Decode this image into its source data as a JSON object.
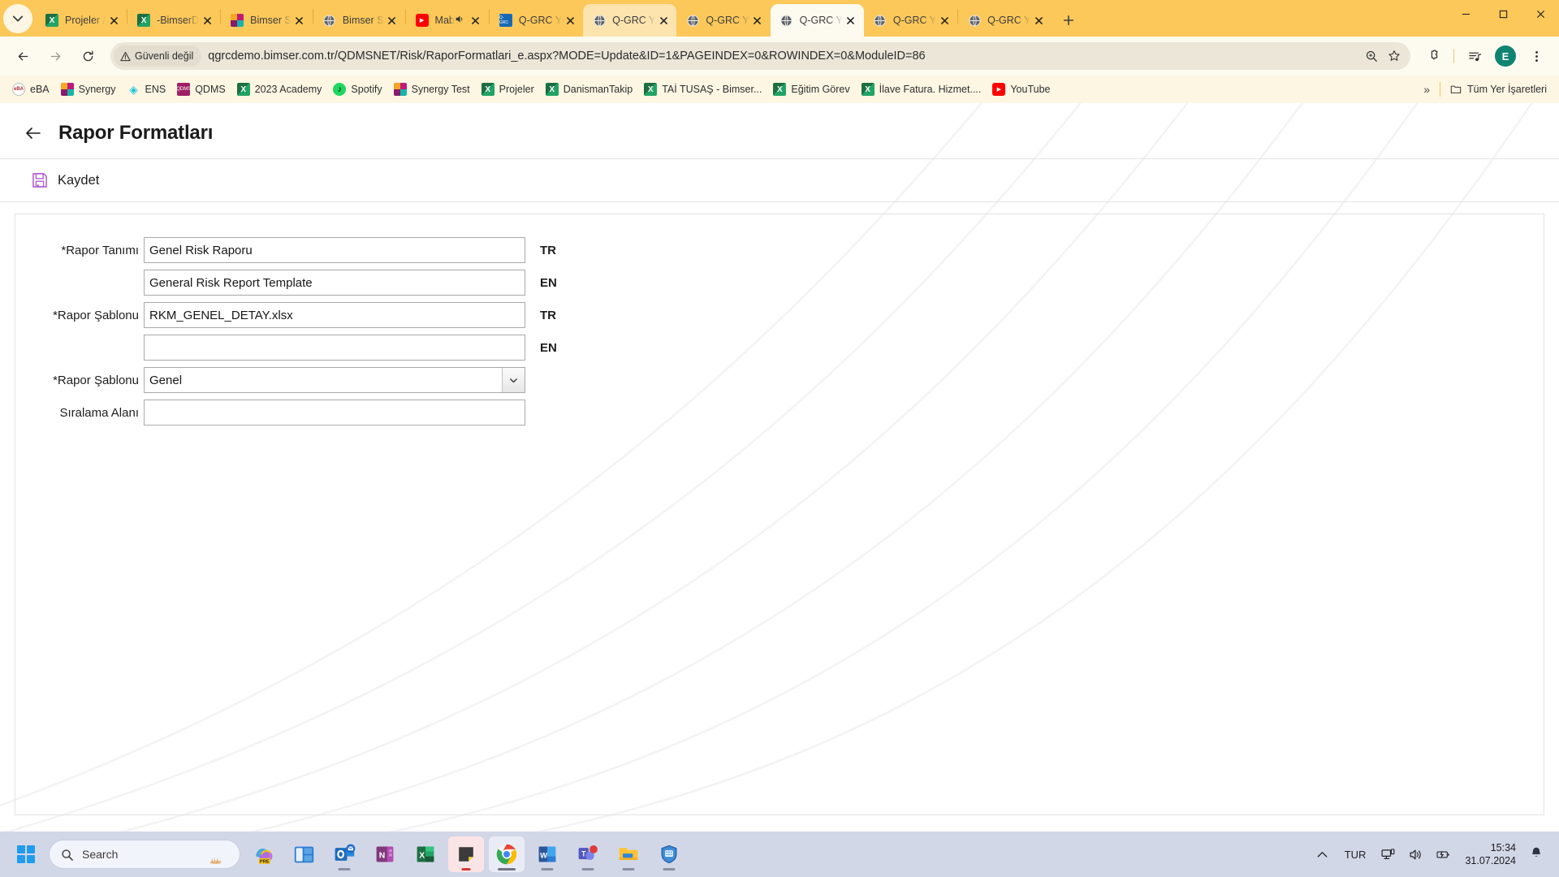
{
  "browser": {
    "tab_search_icon": "chevron-down-icon",
    "tabs": [
      {
        "title": "Projeler /",
        "icon": "excel-icon",
        "state": "normal",
        "audio": false
      },
      {
        "title": "-BimserD",
        "icon": "excel-icon",
        "state": "normal",
        "audio": false
      },
      {
        "title": "Bimser S",
        "icon": "synergy-icon",
        "state": "normal",
        "audio": false
      },
      {
        "title": "Bimser S",
        "icon": "globe-icon",
        "state": "normal",
        "audio": false
      },
      {
        "title": "Mab",
        "icon": "youtube-icon",
        "state": "normal",
        "audio": true
      },
      {
        "title": "Q-GRC Y",
        "icon": "qgrc-icon",
        "state": "normal",
        "audio": false
      },
      {
        "title": "Q-GRC Y",
        "icon": "globe-icon",
        "state": "hover",
        "audio": false
      },
      {
        "title": "Q-GRC Y",
        "icon": "globe-icon",
        "state": "normal",
        "audio": false
      },
      {
        "title": "Q-GRC Y",
        "icon": "globe-icon",
        "state": "active",
        "audio": false
      },
      {
        "title": "Q-GRC Y",
        "icon": "globe-icon",
        "state": "normal",
        "audio": false
      },
      {
        "title": "Q-GRC Y",
        "icon": "globe-icon",
        "state": "normal",
        "audio": false
      }
    ],
    "new_tab_label": "+",
    "window_controls": [
      "minimize",
      "maximize",
      "close"
    ],
    "nav": {
      "back": "back-arrow",
      "forward": "forward-arrow",
      "reload": "reload-icon"
    },
    "omnibox": {
      "security_label": "Güvenli değil",
      "security_icon": "warning-triangle-icon",
      "url": "qgrcdemo.bimser.com.tr/QDMSNET/Risk/RaporFormatlari_e.aspx?MODE=Update&ID=1&PAGEINDEX=0&ROWINDEX=0&ModuleID=86",
      "zoom_icon": "zoom-in-icon",
      "bookmark_icon": "star-icon"
    },
    "extensions_icon": "puzzle-icon",
    "media_icon": "media-list-icon",
    "profile_initial": "E",
    "menu_icon": "three-dots-icon",
    "bookmarks": [
      {
        "label": "eBA",
        "icon": "eba-icon"
      },
      {
        "label": "Synergy",
        "icon": "synergy-icon"
      },
      {
        "label": "ENS",
        "icon": "ens-icon"
      },
      {
        "label": "QDMS",
        "icon": "qdms-icon"
      },
      {
        "label": "2023 Academy",
        "icon": "excel-icon"
      },
      {
        "label": "Spotify",
        "icon": "spotify-icon"
      },
      {
        "label": "Synergy Test",
        "icon": "synergy-icon"
      },
      {
        "label": "Projeler",
        "icon": "excel-icon"
      },
      {
        "label": "DanismanTakip",
        "icon": "excel-icon"
      },
      {
        "label": "TAİ TUSAŞ - Bimser...",
        "icon": "excel-icon"
      },
      {
        "label": "Eğitim Görev",
        "icon": "excel-icon"
      },
      {
        "label": "İlave Fatura. Hizmet....",
        "icon": "excel-icon"
      },
      {
        "label": "YouTube",
        "icon": "youtube-icon"
      }
    ],
    "bookmarks_overflow": "»",
    "all_bookmarks_label": "Tüm Yer İşaretleri",
    "all_bookmarks_icon": "folder-icon"
  },
  "page": {
    "back_icon": "back-arrow-icon",
    "title": "Rapor Formatları",
    "save": {
      "label": "Kaydet",
      "icon": "save-floppy-icon",
      "color": "#a855c4"
    },
    "form": {
      "rows": [
        {
          "label": "*Rapor Tanımı",
          "type": "text",
          "value": "Genel Risk Raporu",
          "lang": "TR",
          "name": "rapor-tanimi-tr"
        },
        {
          "label": "",
          "type": "text",
          "value": "General Risk Report Template",
          "lang": "EN",
          "name": "rapor-tanimi-en"
        },
        {
          "label": "*Rapor Şablonu",
          "type": "text",
          "value": "RKM_GENEL_DETAY.xlsx",
          "lang": "TR",
          "name": "rapor-sablonu-tr"
        },
        {
          "label": "",
          "type": "text",
          "value": "",
          "lang": "EN",
          "name": "rapor-sablonu-en"
        },
        {
          "label": "*Rapor Şablonu",
          "type": "select",
          "value": "Genel",
          "lang": "",
          "name": "rapor-sablonu-select"
        },
        {
          "label": "Sıralama Alanı",
          "type": "text",
          "value": "",
          "lang": "",
          "name": "siralama-alani"
        }
      ]
    }
  },
  "taskbar": {
    "start_icon": "windows-logo-icon",
    "search_placeholder": "Search",
    "apps": [
      {
        "name": "copilot-icon",
        "label": "PRE",
        "running": false
      },
      {
        "name": "widgets-icon",
        "label": "",
        "running": false
      },
      {
        "name": "outlook-icon",
        "label": "",
        "running": true
      },
      {
        "name": "onenote-icon",
        "label": "",
        "running": false
      },
      {
        "name": "excel-icon",
        "label": "",
        "running": false
      },
      {
        "name": "sticky-notes-icon",
        "label": "",
        "running": true
      },
      {
        "name": "chrome-icon",
        "label": "",
        "running": true
      },
      {
        "name": "word-icon",
        "label": "",
        "running": true
      },
      {
        "name": "teams-icon",
        "label": "",
        "running": true
      },
      {
        "name": "file-explorer-icon",
        "label": "",
        "running": true
      },
      {
        "name": "security-icon",
        "label": "",
        "running": true
      }
    ],
    "tray": {
      "overflow_icon": "chevron-up-icon",
      "language": "TUR",
      "network_icon": "network-icon",
      "volume_icon": "volume-icon",
      "battery_icon": "battery-charging-icon",
      "time": "15:34",
      "date": "31.07.2024",
      "notification_icon": "bell-icon"
    }
  }
}
